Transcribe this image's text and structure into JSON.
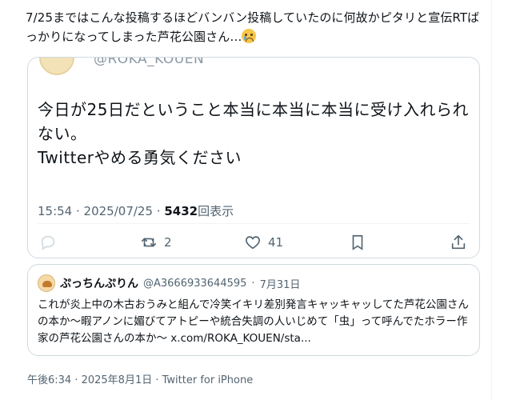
{
  "post": {
    "text": "7/25まではこんな投稿するほどバンバン投稿していたのに何故かピタリと宣伝RTばっかりになってしまった芦花公園さん…",
    "emoji_icon": "crying-face-emoji"
  },
  "embedded_tweet": {
    "handle": "@ROKA_KOUEN",
    "body": "今日が25日だということ本当に本当に本当に受け入れられない。\nTwitterやめる勇気ください",
    "time": "15:54",
    "date": "2025/07/25",
    "views_count": "5432",
    "views_label": "回表示",
    "actions": {
      "reply_count": "",
      "retweet_count": "2",
      "like_count": "41"
    }
  },
  "quoted_tweet": {
    "name": "ぷっちんぷりん",
    "handle": "@A3666933644595",
    "date": "7月31日",
    "body": "これが炎上中の木古おうみと組んで冷笑イキリ差別発言キャッキャッしてた芦花公園さんの本か～暇アノンに媚びてアトピーや統合失調の人いじめて「虫」って呼んでたホラー作家の芦花公園さんの本か～ x.com/ROKA_KOUEN/sta..."
  },
  "footer": {
    "timestamp": "午後6:34 · 2025年8月1日 · Twitter for iPhone"
  },
  "colors": {
    "text": "#0f1419",
    "secondary": "#536471",
    "border": "#cfd9de"
  }
}
